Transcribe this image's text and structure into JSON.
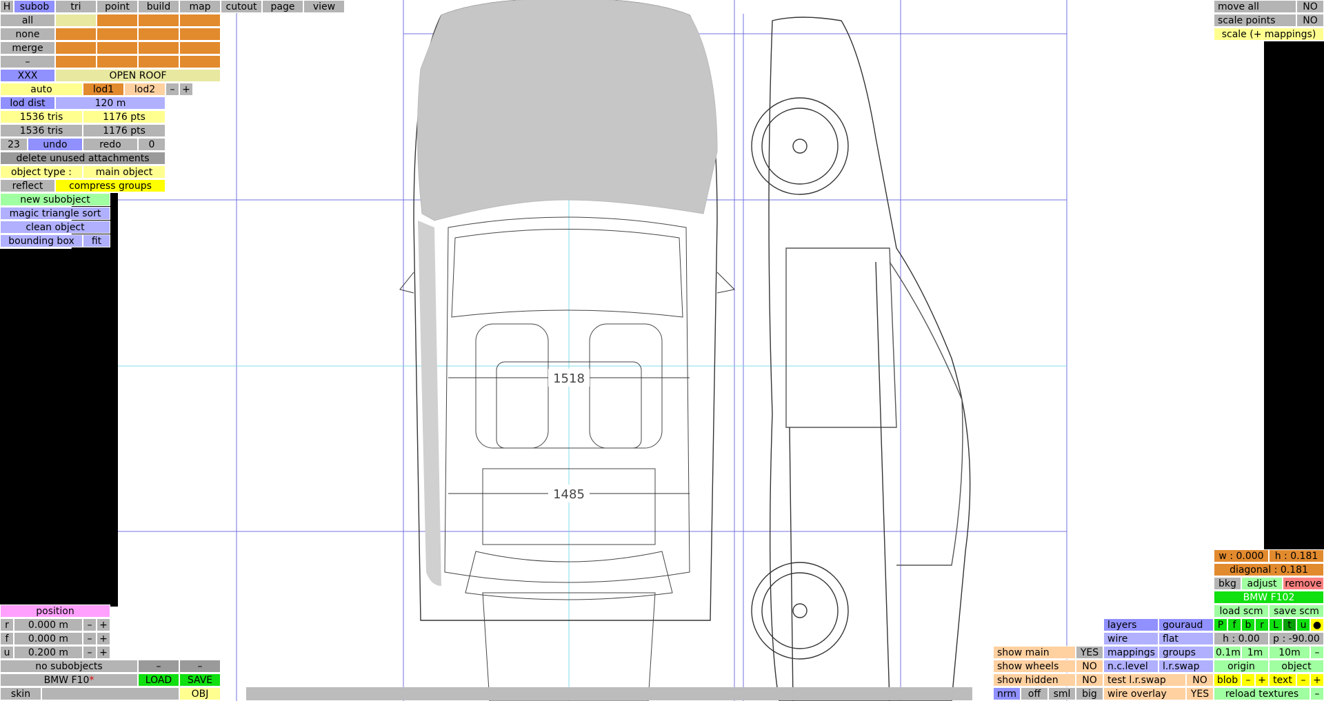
{
  "toolbar": {
    "h": "H",
    "tabs": [
      "subob",
      "tri",
      "point",
      "build",
      "map",
      "cutout",
      "page",
      "view"
    ]
  },
  "groups": {
    "all": "all",
    "none": "none",
    "merge": "merge",
    "dash": "–"
  },
  "subobject_name": {
    "id": "XXX",
    "label": "OPEN ROOF"
  },
  "lod": {
    "auto": "auto",
    "lod1": "lod1",
    "lod2": "lod2",
    "minus": "–",
    "plus": "+"
  },
  "lod_dist": {
    "label": "lod dist",
    "value": "120 m"
  },
  "stats": [
    {
      "tris": "1536 tris",
      "pts": "1176 pts"
    },
    {
      "tris": "1536 tris",
      "pts": "1176 pts"
    }
  ],
  "history": {
    "undo_count": "23",
    "undo": "undo",
    "redo": "redo",
    "redo_count": "0"
  },
  "delete_unused": "delete unused attachments",
  "object_type": {
    "label": "object type :",
    "value": "main object"
  },
  "reflect": "reflect",
  "compress_groups": "compress groups",
  "actions": {
    "new_subobject": "new subobject",
    "magic_sort": "magic triangle sort",
    "clean_object": "clean object",
    "bounding_box": "bounding box",
    "fit": "fit"
  },
  "position": {
    "title": "position",
    "rows": [
      {
        "axis": "r",
        "value": "0.000 m"
      },
      {
        "axis": "f",
        "value": "0.000 m"
      },
      {
        "axis": "u",
        "value": "0.200 m"
      }
    ],
    "minus": "–",
    "plus": "+"
  },
  "subobjects": {
    "label": "no subobjects",
    "d1": "–",
    "d2": "–"
  },
  "file": {
    "name": "BMW F10",
    "modified": "*",
    "load": "LOAD",
    "save": "SAVE"
  },
  "skin": {
    "label": "skin",
    "obj": "OBJ"
  },
  "top_right": {
    "move_all": "move all",
    "move_all_val": "NO",
    "scale_points": "scale points",
    "scale_points_val": "NO",
    "scale_map": "scale (+ mappings)"
  },
  "dims": {
    "w": "w : 0.000",
    "h": "h : 0.181",
    "diagonal": "diagonal : 0.181"
  },
  "bkg": {
    "bkg": "bkg",
    "adjust": "adjust",
    "remove": "remove",
    "name": "BMW F102",
    "load_scm": "load scm",
    "save_scm": "save scm"
  },
  "views": [
    "P",
    "f",
    "b",
    "r",
    "L",
    "t",
    "u",
    "●"
  ],
  "camera": {
    "h": "h : 0.00",
    "p": "p : -90.00",
    "s1": "0.1m",
    "s2": "1m",
    "s3": "10m",
    "dash": "–",
    "origin": "origin",
    "object": "object"
  },
  "render": {
    "layers": "layers",
    "gouraud": "gouraud",
    "wire": "wire",
    "flat": "flat",
    "mappings": "mappings",
    "groups": "groups",
    "nc_level": "n.c.level",
    "lr_swap": "l.r.swap",
    "test_lr_swap": "test l.r.swap",
    "test_lr_val": "NO",
    "wire_overlay": "wire overlay",
    "wire_overlay_val": "YES"
  },
  "show": {
    "main": "show main",
    "main_val": "YES",
    "wheels": "show wheels",
    "wheels_val": "NO",
    "hidden": "show hidden",
    "hidden_val": "NO"
  },
  "size_btns": [
    "nrm",
    "off",
    "sml",
    "big"
  ],
  "blobtext": {
    "blob": "blob",
    "minus": "–",
    "plus": "+",
    "text": "text"
  },
  "reload": "reload textures",
  "canvas": {
    "dim1": "1518",
    "dim2": "1485"
  }
}
